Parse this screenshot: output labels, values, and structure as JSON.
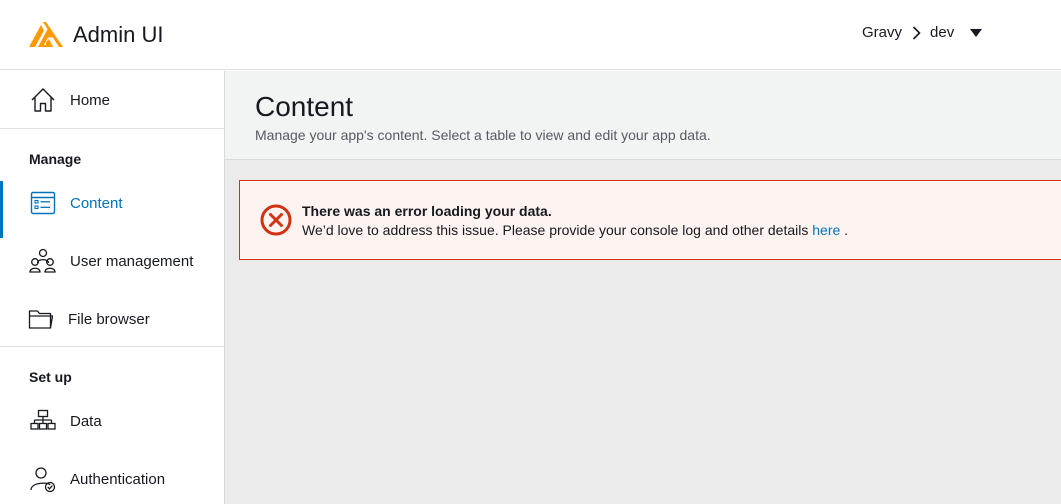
{
  "header": {
    "app_title": "Admin UI",
    "app_name": "Gravy",
    "environment": "dev",
    "brand_color": "#ff9900"
  },
  "sidebar": {
    "home": "Home",
    "manage_title": "Manage",
    "content": "Content",
    "user_management": "User management",
    "file_browser": "File browser",
    "setup_title": "Set up",
    "data": "Data",
    "authentication": "Authentication"
  },
  "main": {
    "title": "Content",
    "description": "Manage your app's content. Select a table to view and edit your app data."
  },
  "alert": {
    "title": "There was an error loading your data.",
    "body": "We’d love to address this issue. Please provide your console log and other details",
    "link": "here",
    "suffix": " .",
    "color": "#d13212"
  }
}
